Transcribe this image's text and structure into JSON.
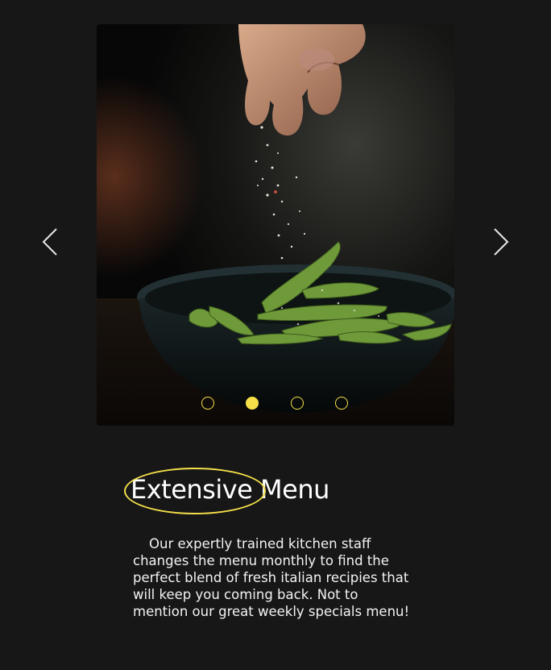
{
  "carousel": {
    "slide_alt": "Hand sprinkling salt over edamame in a dark bowl",
    "prev_icon": "chevron-left-icon",
    "next_icon": "chevron-right-icon",
    "slide_count": 4,
    "active_index": 1
  },
  "feature": {
    "highlight_word": "Extensive",
    "rest_word": "Menu",
    "description": "Our expertly trained kitchen staff changes the menu monthly to find the perfect blend of fresh italian recipies that will keep you coming back. Not to mention our great weekly specials menu!"
  },
  "colors": {
    "background": "#171717",
    "accent": "#f5e04a",
    "text": "#ffffff"
  }
}
